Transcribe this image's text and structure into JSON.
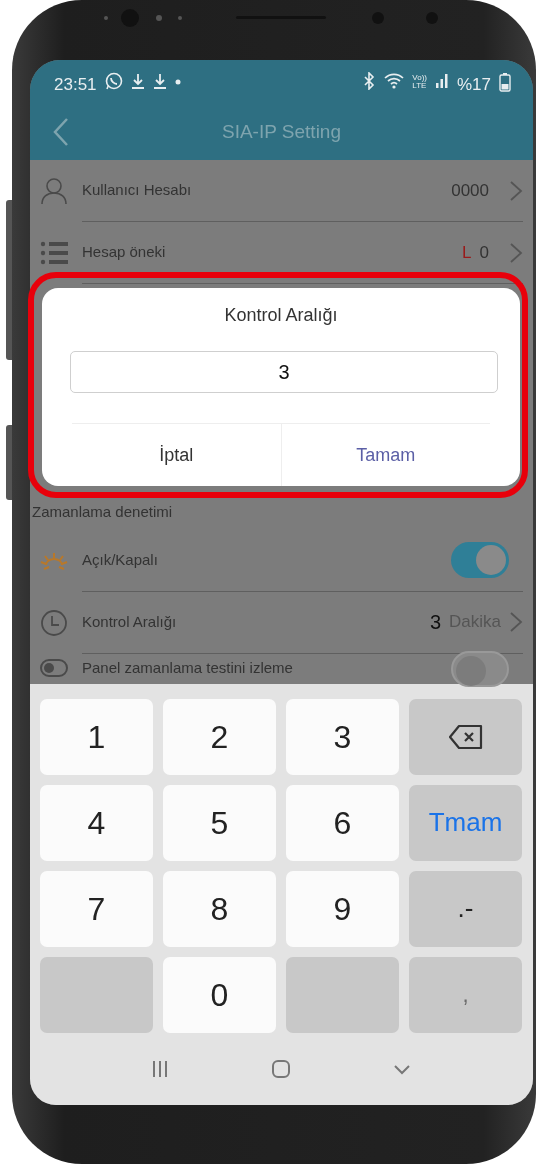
{
  "status_bar": {
    "time": "23:51",
    "network": [
      "Vo))",
      "LTE"
    ],
    "battery": "%17"
  },
  "header": {
    "title": "SIA-IP Setting"
  },
  "rows_top": [
    {
      "label": "Kullanıcı Hesabı",
      "value": "0000"
    },
    {
      "label": "Hesap öneki",
      "prefix": "L",
      "value": "0"
    }
  ],
  "section": "Zamanlama denetimi",
  "rows": [
    {
      "kind": "toggle",
      "label": "Açık/Kapalı",
      "on": true
    },
    {
      "kind": "value",
      "label": "Kontrol Aralığı",
      "value": "3",
      "unit": "Dakika"
    },
    {
      "kind": "toggle",
      "label": "Panel zamanlama testini izleme",
      "on": false
    }
  ],
  "dialog": {
    "title": "Kontrol Aralığı",
    "value": "3",
    "buttons": [
      {
        "label": "İptal",
        "primary": false
      },
      {
        "label": "Tamam",
        "primary": true
      }
    ]
  },
  "keyboard": {
    "keys": [
      {
        "kind": "digit",
        "label": "1"
      },
      {
        "kind": "digit",
        "label": "2"
      },
      {
        "kind": "digit",
        "label": "3"
      },
      {
        "kind": "backspace"
      },
      {
        "kind": "digit",
        "label": "4"
      },
      {
        "kind": "digit",
        "label": "5"
      },
      {
        "kind": "digit",
        "label": "6"
      },
      {
        "kind": "action",
        "label": "Tmam"
      },
      {
        "kind": "digit",
        "label": "7"
      },
      {
        "kind": "digit",
        "label": "8"
      },
      {
        "kind": "digit",
        "label": "9"
      },
      {
        "kind": "symbol",
        "label": ".-"
      },
      {
        "kind": "blank"
      },
      {
        "kind": "digit",
        "label": "0"
      },
      {
        "kind": "blank"
      },
      {
        "kind": "faint",
        "label": ","
      }
    ]
  }
}
